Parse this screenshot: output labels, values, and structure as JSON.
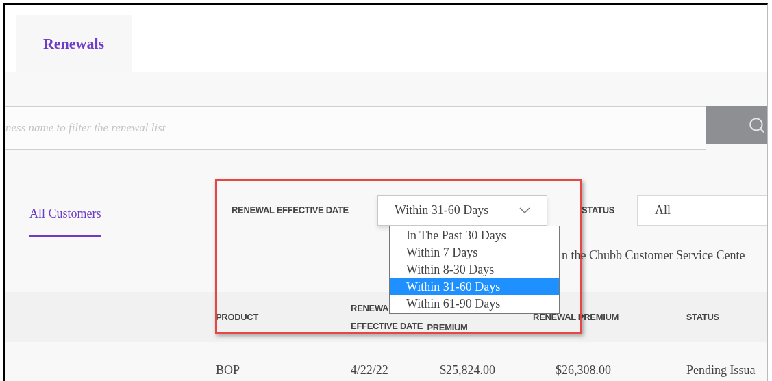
{
  "tabs": [
    {
      "label": "Renewals",
      "selected": true
    }
  ],
  "search": {
    "placeholder": "ness name to filter the renewal list"
  },
  "customer_tabs": [
    {
      "label": "All Customers",
      "selected": true
    }
  ],
  "filters": {
    "date_label": "RENEWAL EFFECTIVE DATE",
    "date_value": "Within 31-60 Days",
    "status_label": "STATUS",
    "status_value": "All"
  },
  "date_options": [
    {
      "label": "In The Past 30 Days",
      "selected": false
    },
    {
      "label": "Within 7 Days",
      "selected": false
    },
    {
      "label": "Within 8-30 Days",
      "selected": false
    },
    {
      "label": "Within 31-60 Days",
      "selected": true
    },
    {
      "label": "Within 61-90 Days",
      "selected": false
    }
  ],
  "info_text": "n the Chubb Customer Service Cente",
  "table": {
    "columns": [
      {
        "lines": [
          "PRODUCT"
        ]
      },
      {
        "lines": [
          "RENEWA",
          "EFFECTIVE DATE"
        ]
      },
      {
        "lines": [
          "PREMIUM"
        ]
      },
      {
        "lines": [
          "RENEWAL PREMIUM"
        ]
      },
      {
        "lines": [
          "STATUS"
        ]
      }
    ],
    "rows": [
      [
        "BOP",
        "4/22/22",
        "$25,824.00",
        "$26,308.00",
        "Pending Issua"
      ]
    ]
  }
}
